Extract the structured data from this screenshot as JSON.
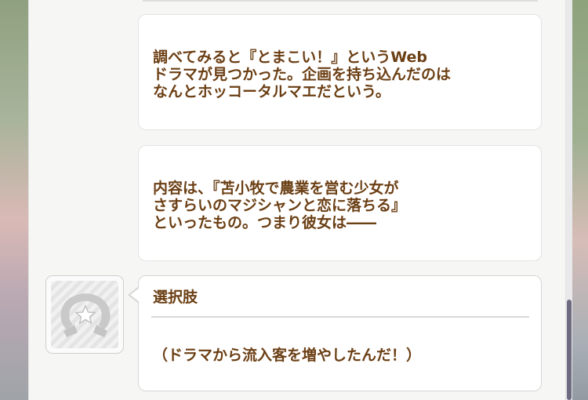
{
  "messages": [
    {
      "lines": [
        "調べてみると『とまこい！』というWeb",
        "ドラマが見つかった。企画を持ち込んだのは",
        "なんとホッコータルマエだという。"
      ]
    },
    {
      "lines": [
        "内容は、『苫小牧で農業を営む少女が",
        "さすらいのマジシャンと恋に落ちる』",
        "といったもの。つまり彼女は――"
      ]
    }
  ],
  "choice": {
    "title": "選択肢",
    "option": "（ドラマから流入客を増やしたんだ！）"
  },
  "avatar": {
    "icon": "horseshoe-star-placeholder-icon"
  },
  "colors": {
    "text": "#6b3f14",
    "bubble_bg": "#ffffff",
    "panel_bg": "#f6f6f5",
    "scroll_thumb": "#6e6a80"
  }
}
